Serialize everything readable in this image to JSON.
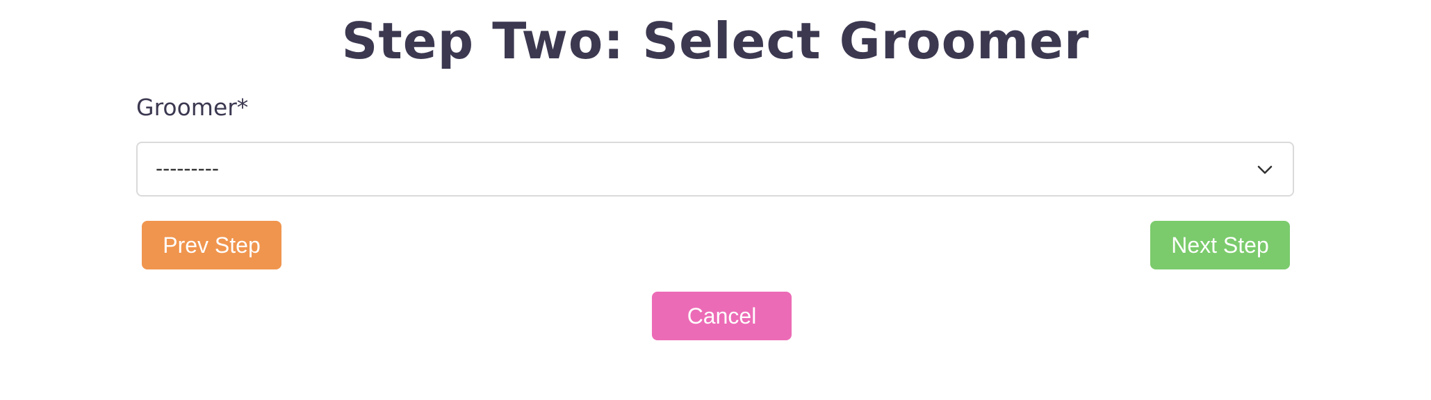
{
  "title": "Step Two: Select Groomer",
  "groomer_field": {
    "label": "Groomer*",
    "selected_value": "---------",
    "icon": "chevron-down-icon"
  },
  "buttons": {
    "prev_label": "Prev Step",
    "next_label": "Next Step",
    "cancel_label": "Cancel"
  },
  "colors": {
    "title_text": "#3b3850",
    "prev_button": "#f0954e",
    "next_button": "#7bcb6c",
    "cancel_button": "#ec6bb6",
    "select_border": "#dadada"
  }
}
